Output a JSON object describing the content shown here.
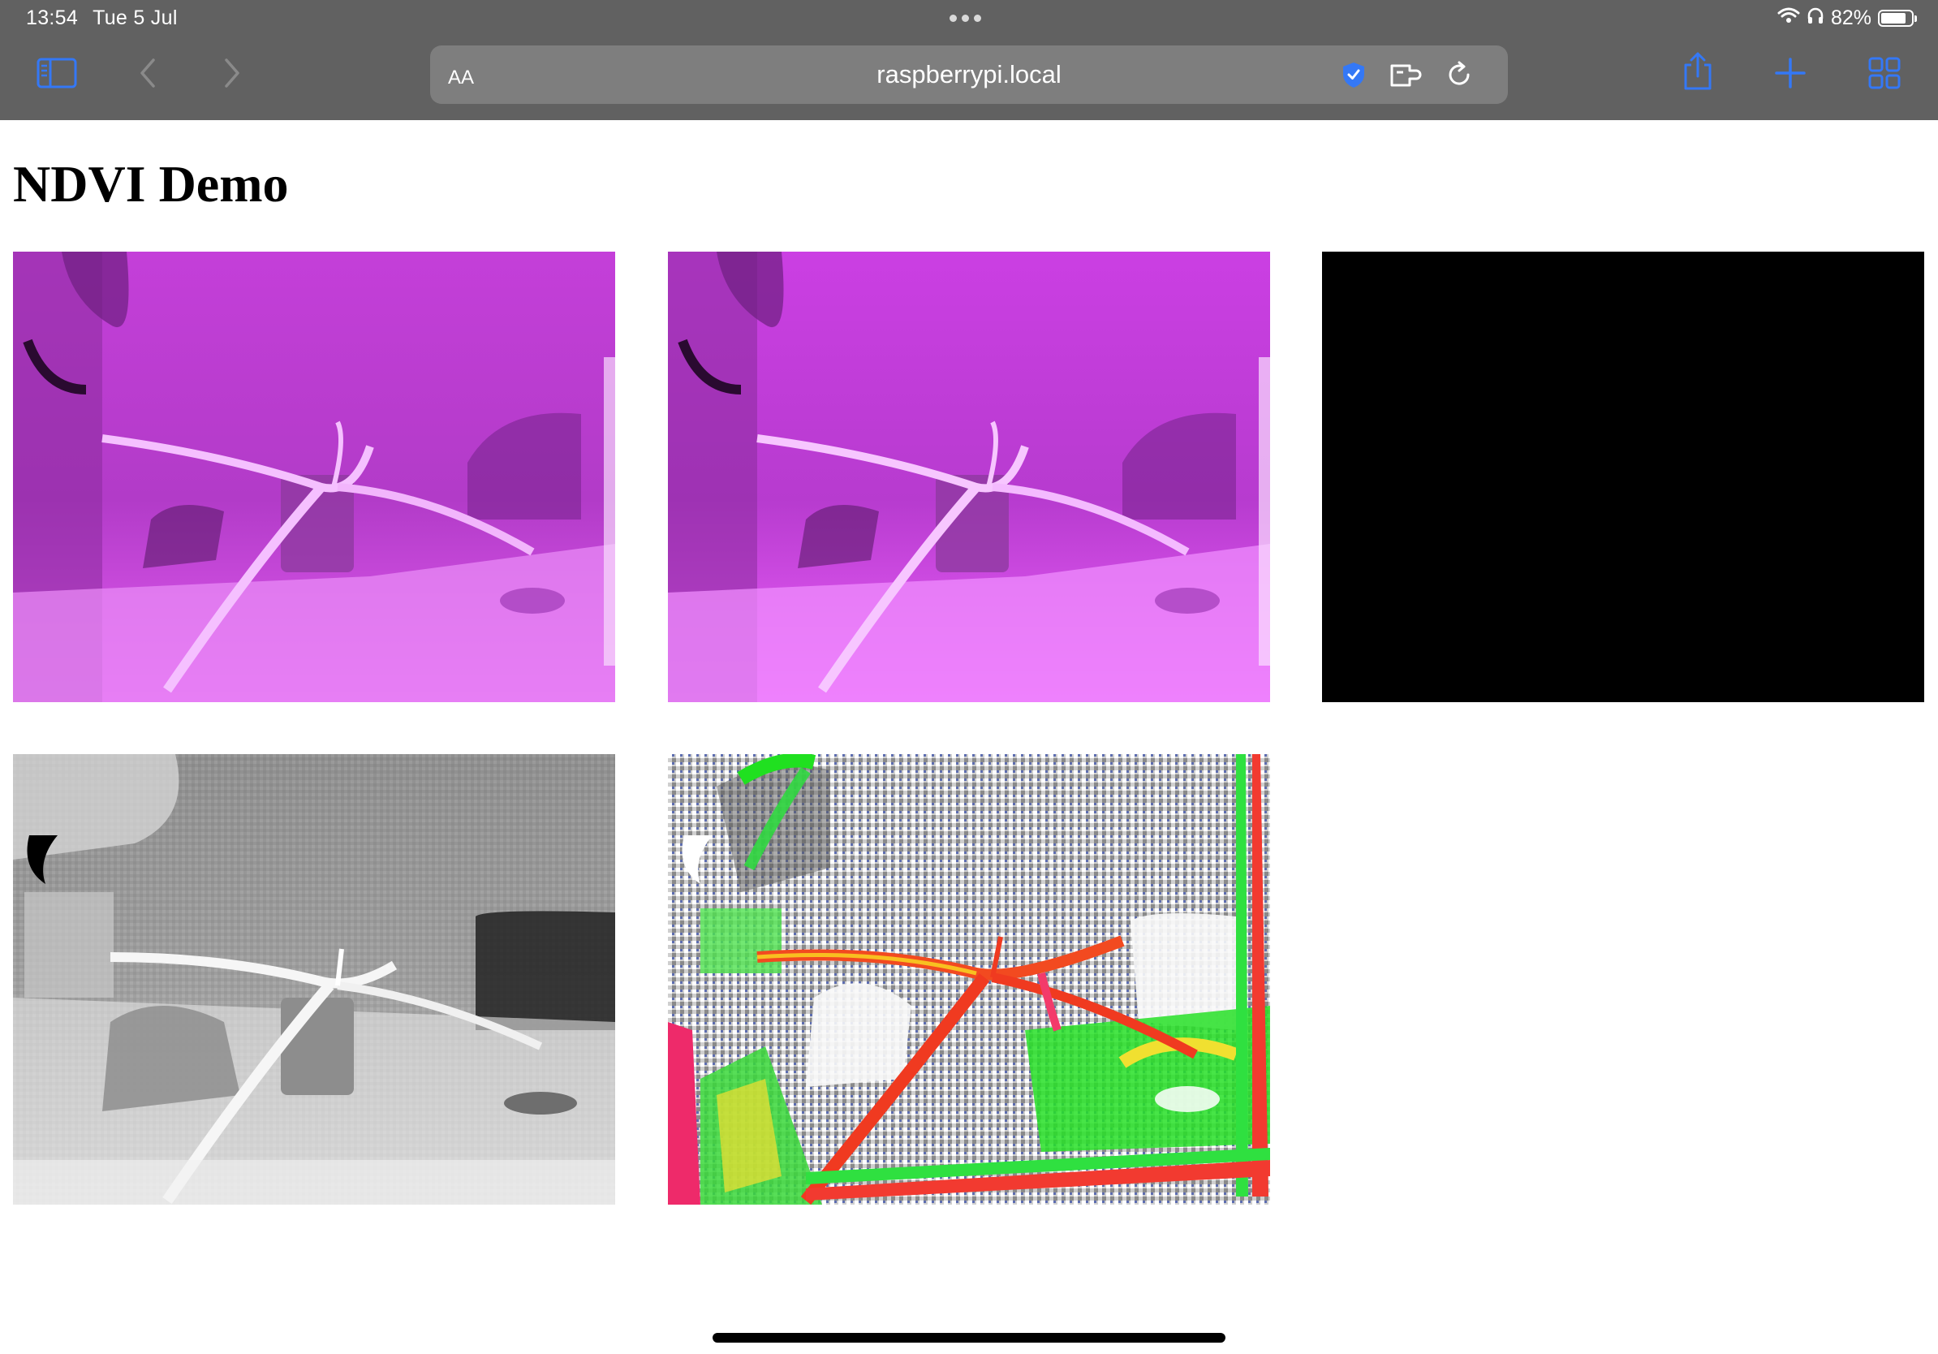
{
  "status_bar": {
    "time": "13:54",
    "date": "Tue 5 Jul",
    "battery_text": "82%",
    "battery_level": 0.82
  },
  "toolbar": {
    "text_size_label": "AA",
    "url": "raspberrypi.local",
    "icons": [
      "sidebar-icon",
      "back-icon",
      "forward-icon",
      "privacy-shield-icon",
      "extensions-icon",
      "reload-icon",
      "share-icon",
      "new-tab-icon",
      "tab-overview-icon"
    ]
  },
  "page": {
    "title": "NDVI Demo",
    "images": [
      {
        "kind": "camera-nir-purple"
      },
      {
        "kind": "camera-nir-purple-contrast"
      },
      {
        "kind": "black"
      },
      {
        "kind": "grayscale-ndvi"
      },
      {
        "kind": "colormapped-ndvi"
      }
    ]
  },
  "colors": {
    "chrome": "#616161",
    "address_bar": "#7e7e7e",
    "accent": "#3478f6"
  }
}
